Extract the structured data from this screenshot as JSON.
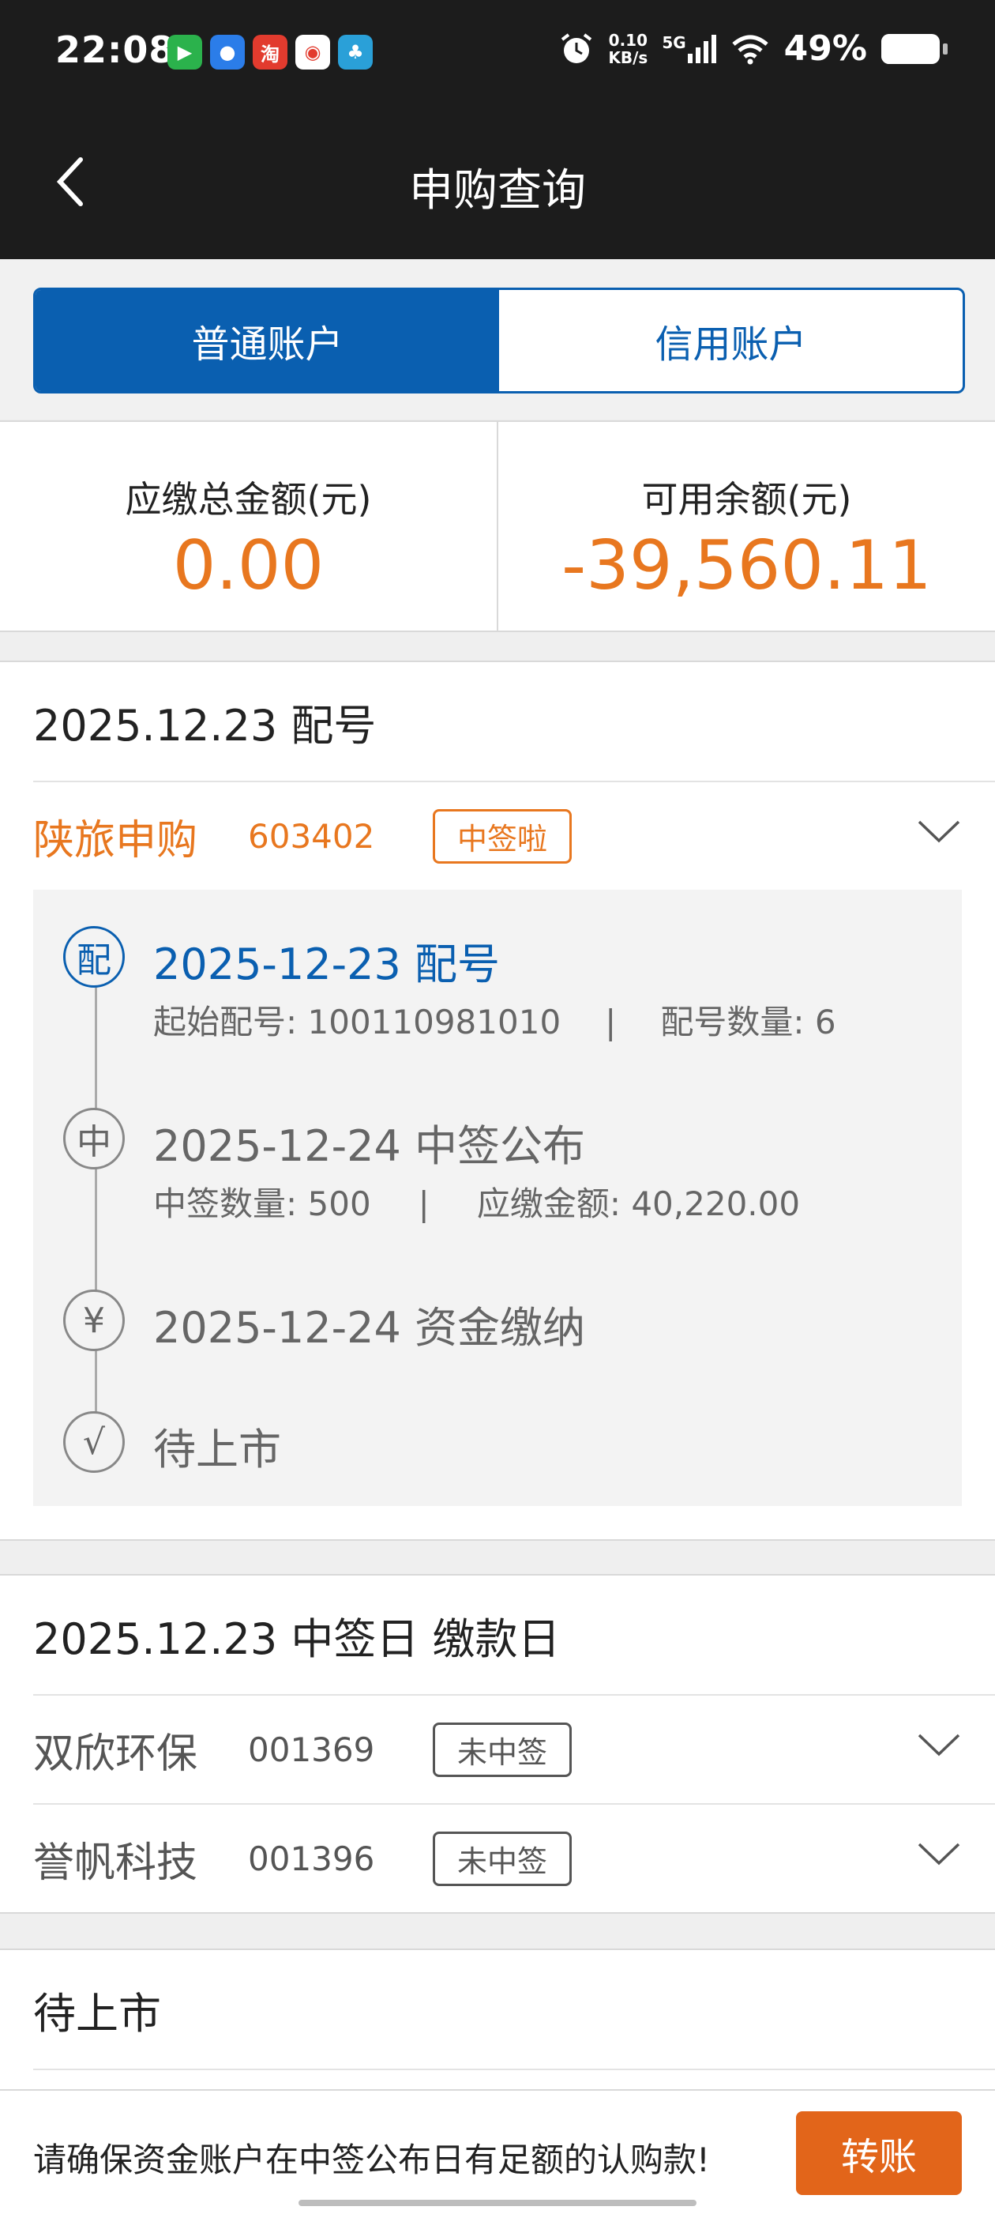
{
  "status_bar": {
    "time": "22:08",
    "net_speed_value": "0.10",
    "net_speed_unit": "KB/s",
    "network": "5G",
    "battery": "49%"
  },
  "header": {
    "title": "申购查询"
  },
  "tabs": [
    {
      "label": "普通账户",
      "active": true
    },
    {
      "label": "信用账户",
      "active": false
    }
  ],
  "summary": {
    "due_label": "应缴总金额(元)",
    "due_value": "0.00",
    "available_label": "可用余额(元)",
    "available_value": "-39,560.11"
  },
  "section1": {
    "title": "2025.12.23 配号",
    "stock": {
      "name": "陕旅申购",
      "code": "603402",
      "badge": "中签啦"
    },
    "timeline": [
      {
        "icon": "配",
        "title": "2025-12-23 配号",
        "detail_a": "起始配号:  100110981010",
        "detail_b": "配号数量: 6"
      },
      {
        "icon": "中",
        "title": "2025-12-24 中签公布",
        "detail_a": "中签数量: 500",
        "detail_b": "应缴金额: 40,220.00"
      },
      {
        "icon": "¥",
        "title": "2025-12-24 资金缴纳"
      },
      {
        "icon": "√",
        "title": "待上市"
      }
    ]
  },
  "section2": {
    "title": "2025.12.23 中签日 缴款日",
    "rows": [
      {
        "name": "双欣环保",
        "code": "001369",
        "badge": "未中签"
      },
      {
        "name": "誉帆科技",
        "code": "001396",
        "badge": "未中签"
      }
    ]
  },
  "section3": {
    "title": "待上市"
  },
  "bottom": {
    "notice": "请确保资金账户在中签公布日有足额的认购款!",
    "transfer_label": "转账"
  },
  "colors": {
    "brand_blue": "#0a5fb0",
    "accent_orange": "#e8771f",
    "header_bg": "#1c1c1c"
  }
}
